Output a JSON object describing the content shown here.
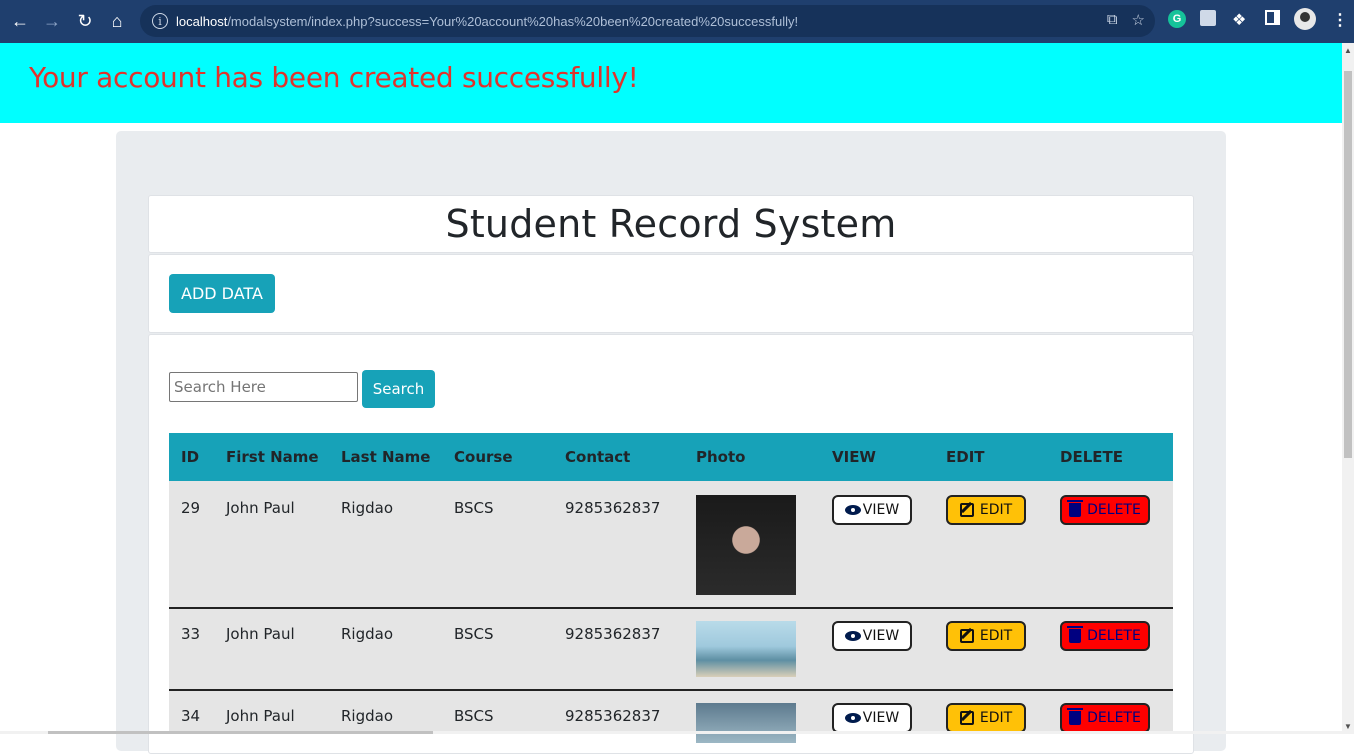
{
  "browser": {
    "url_host": "localhost",
    "url_path": "/modalsystem/index.php?success=Your%20account%20has%20been%20created%20successfully!",
    "extension_letter": "G"
  },
  "alert": {
    "message": "Your account has been created successfully!"
  },
  "page": {
    "title": "Student Record System",
    "add_button": "ADD DATA",
    "search_placeholder": "Search Here",
    "search_value": "",
    "search_button": "Search"
  },
  "table": {
    "headers": [
      "ID",
      "First Name",
      "Last Name",
      "Course",
      "Contact",
      "Photo",
      "VIEW",
      "EDIT",
      "DELETE"
    ],
    "action_labels": {
      "view": "VIEW",
      "edit": "EDIT",
      "delete": "DELETE"
    },
    "rows": [
      {
        "id": "29",
        "first_name": "John Paul",
        "last_name": "Rigdao",
        "course": "BSCS",
        "contact": "9285362837"
      },
      {
        "id": "33",
        "first_name": "John Paul",
        "last_name": "Rigdao",
        "course": "BSCS",
        "contact": "9285362837"
      },
      {
        "id": "34",
        "first_name": "John Paul",
        "last_name": "Rigdao",
        "course": "BSCS",
        "contact": "9285362837"
      }
    ]
  },
  "colors": {
    "banner_bg": "#00ffff",
    "banner_text": "#e0332c",
    "primary_button": "#17a2b8",
    "edit_button": "#ffc107",
    "delete_button": "#ff0000"
  }
}
